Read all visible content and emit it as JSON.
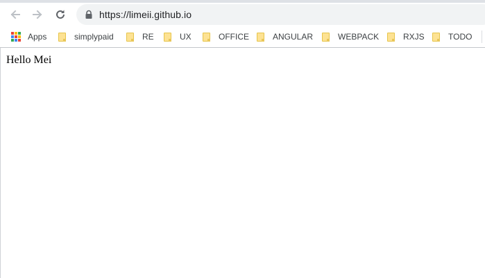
{
  "browser": {
    "url": "https://limeii.github.io",
    "bookmarks": [
      {
        "label": "Apps",
        "type": "apps"
      },
      {
        "label": "simplypaid",
        "type": "folder"
      },
      {
        "label": "RE",
        "type": "folder"
      },
      {
        "label": "UX",
        "type": "folder"
      },
      {
        "label": "OFFICE",
        "type": "folder"
      },
      {
        "label": "ANGULAR",
        "type": "folder"
      },
      {
        "label": "WEBPACK",
        "type": "folder"
      },
      {
        "label": "RXJS",
        "type": "folder"
      },
      {
        "label": "TODO",
        "type": "folder"
      }
    ],
    "icons": {
      "back": "arrow-left-icon",
      "forward": "arrow-right-icon",
      "reload": "reload-icon",
      "security": "lock-icon",
      "apps": "apps-grid-icon",
      "folder": "folder-icon"
    },
    "colors": {
      "omnibox_bg": "#f1f3f4",
      "folder": "#fde293",
      "apps_grid": [
        "#ea4335",
        "#fbbc04",
        "#34a853",
        "#4285f4",
        "#ea4335",
        "#fbbc04",
        "#34a853",
        "#4285f4",
        "#ea4335"
      ]
    }
  },
  "page": {
    "text": "Hello Mei"
  }
}
